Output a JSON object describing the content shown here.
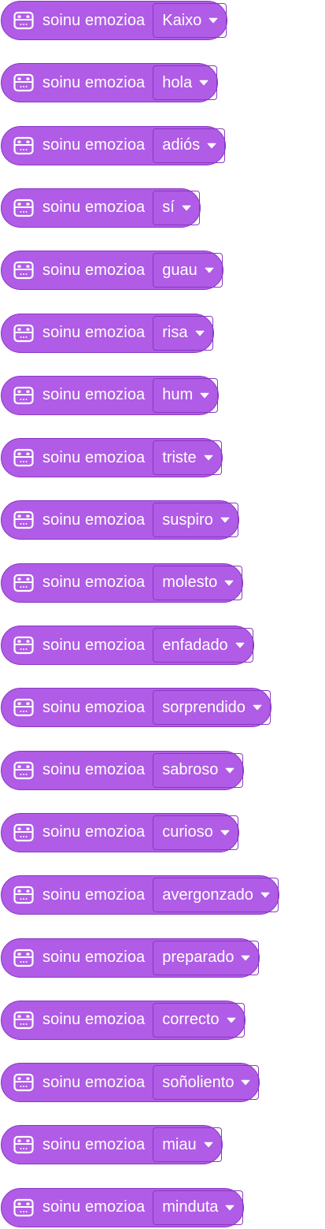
{
  "block_label": "soinu emozioa",
  "colors": {
    "block_fill": "#b05ce6",
    "block_border": "#8a38c4",
    "text": "#ffffff"
  },
  "icons": {
    "block_icon": "robot-face-icon",
    "dropdown_icon": "caret-down-icon"
  },
  "blocks": [
    {
      "value": "Kaixo"
    },
    {
      "value": "hola"
    },
    {
      "value": "adiós"
    },
    {
      "value": "sí"
    },
    {
      "value": "guau"
    },
    {
      "value": "risa"
    },
    {
      "value": "hum"
    },
    {
      "value": "triste"
    },
    {
      "value": "suspiro"
    },
    {
      "value": "molesto"
    },
    {
      "value": "enfadado"
    },
    {
      "value": "sorprendido"
    },
    {
      "value": "sabroso"
    },
    {
      "value": "curioso"
    },
    {
      "value": "avergonzado"
    },
    {
      "value": "preparado"
    },
    {
      "value": "correcto"
    },
    {
      "value": "soñoliento"
    },
    {
      "value": "miau"
    },
    {
      "value": "minduta"
    }
  ]
}
